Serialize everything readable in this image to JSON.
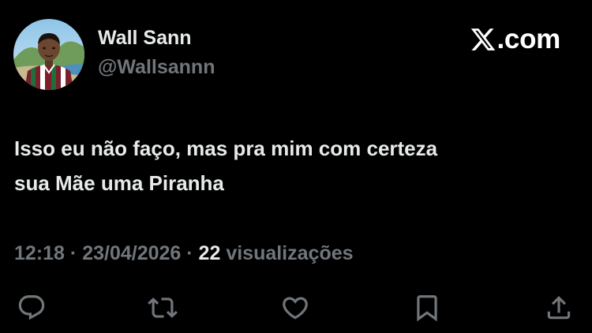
{
  "author": {
    "display_name": "Wall Sann",
    "handle": "@Wallsannn",
    "avatar_icon": "profile-avatar"
  },
  "brand": {
    "icon": "x-logo-icon",
    "text": ".com"
  },
  "tweet": {
    "lines": [
      "Isso eu não faço, mas pra mim com certeza",
      "sua Mãe uma Piranha"
    ]
  },
  "meta": {
    "time": "12:18",
    "separator": "·",
    "date": "23/04/2026",
    "views_count": "22",
    "views_label": "visualizações"
  },
  "actions": [
    {
      "name": "reply",
      "icon": "reply-icon"
    },
    {
      "name": "repost",
      "icon": "repost-icon"
    },
    {
      "name": "like",
      "icon": "heart-icon"
    },
    {
      "name": "bookmark",
      "icon": "bookmark-icon"
    },
    {
      "name": "share",
      "icon": "share-icon"
    }
  ],
  "colors": {
    "background": "#000000",
    "primary_text": "#e7e9ea",
    "secondary_text": "#71767b"
  }
}
